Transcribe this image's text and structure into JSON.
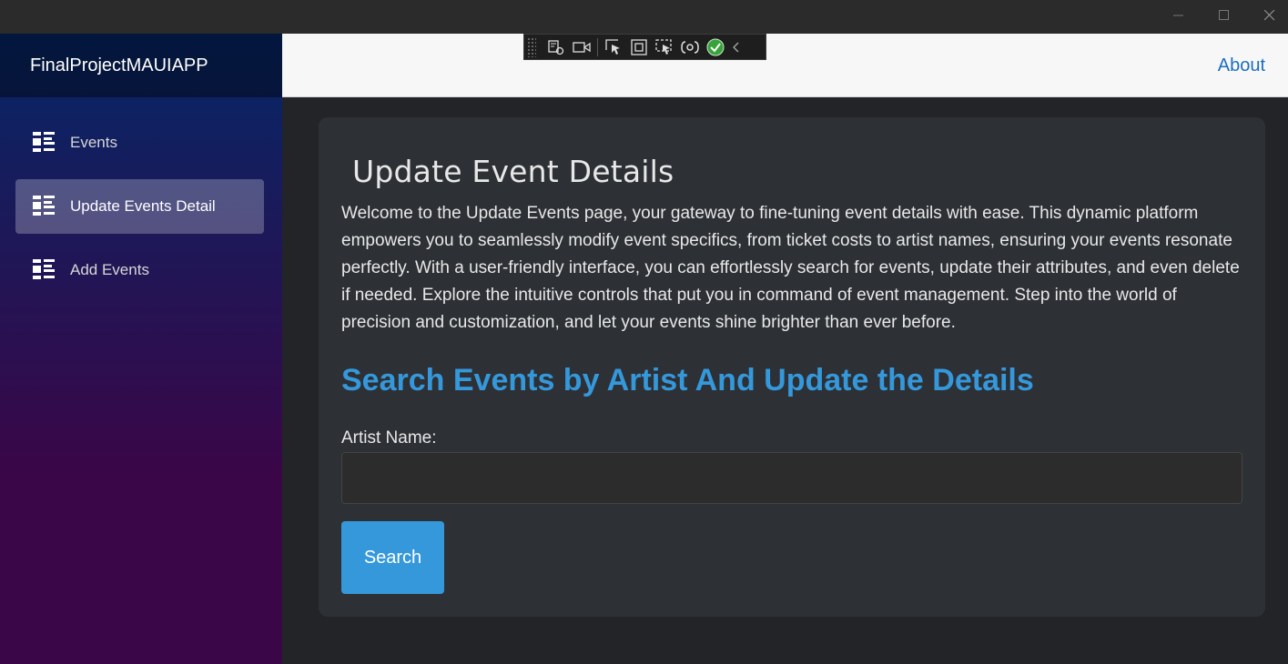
{
  "window": {
    "controls": [
      {
        "name": "minimize",
        "icon": "minimize-icon"
      },
      {
        "name": "maximize",
        "icon": "maximize-icon"
      },
      {
        "name": "close",
        "icon": "close-icon"
      }
    ]
  },
  "sidebar": {
    "brand": "FinalProjectMAUIAPP",
    "items": [
      {
        "label": "Events",
        "icon": "list-icon",
        "active": false
      },
      {
        "label": "Update Events Detail",
        "icon": "list-icon",
        "active": true
      },
      {
        "label": "Add Events",
        "icon": "list-icon",
        "active": false
      }
    ]
  },
  "header": {
    "about_label": "About"
  },
  "debug_toolbar": {
    "buttons": [
      "live-visual-tree-icon",
      "record-icon",
      "select-element-icon",
      "display-layout-adorners-icon",
      "track-focus-icon",
      "binding-failures-icon",
      "hot-reload-ok-icon",
      "collapse-chevron-icon"
    ]
  },
  "main": {
    "title": "Update Event Details",
    "intro": "Welcome to the Update Events page, your gateway to fine-tuning event details with ease. This dynamic platform empowers you to seamlessly modify event specifics, from ticket costs to artist names, ensuring your events resonate perfectly. With a user-friendly interface, you can effortlessly search for events, update their attributes, and even delete if needed. Explore the intuitive controls that put you in command of event management. Step into the world of precision and customization, and let your events shine brighter than ever before.",
    "section_heading": "Search Events by Artist And Update the Details",
    "artist_label": "Artist Name:",
    "artist_value": "",
    "search_label": "Search"
  },
  "colors": {
    "accent": "#3498db",
    "link": "#1b6ec2",
    "sidebar_top": "#052767",
    "sidebar_bottom": "#3a0647",
    "card_bg": "#2d3035",
    "page_bg": "#222428"
  }
}
